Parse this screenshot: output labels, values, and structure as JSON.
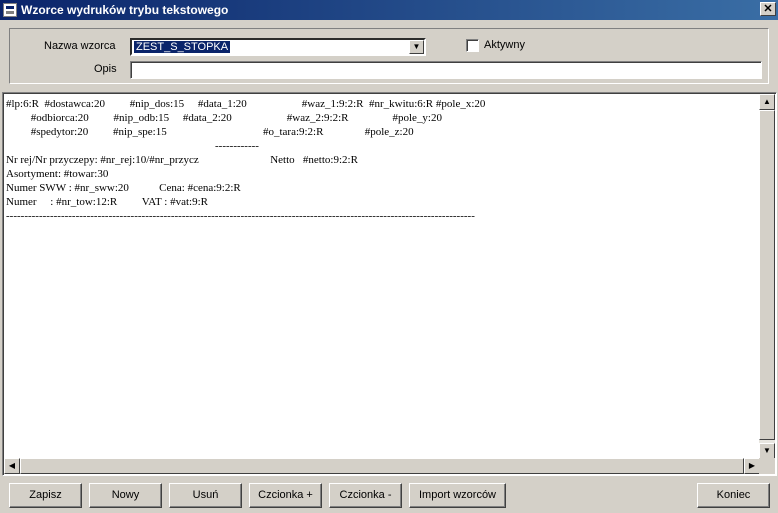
{
  "window": {
    "title": "Wzorce wydruków trybu tekstowego",
    "close_glyph": "✕"
  },
  "form": {
    "name_label": "Nazwa wzorca",
    "name_value": "ZEST_S_STOPKA",
    "active_label": "Aktywny",
    "active_checked": false,
    "description_label": "Opis",
    "description_value": ""
  },
  "editor": {
    "text": "#lp:6:R  #dostawca:20         #nip_dos:15     #data_1:20                    #waz_1:9:2:R  #nr_kwitu:6:R #pole_x:20\n         #odbiorca:20         #nip_odb:15     #data_2:20                    #waz_2:9:2:R                #pole_y:20\n         #spedytor:20         #nip_spe:15                                   #o_tara:9:2:R               #pole_z:20\n                                                                            ------------\nNr rej/Nr przyczepy: #nr_rej:10/#nr_przycz                          Netto   #netto:9:2:R\nAsortyment: #towar:30\nNumer SWW : #nr_sww:20           Cena: #cena:9:2:R\nNumer     : #nr_tow:12:R         VAT : #vat:9:R\n--------------------------------------------------------------------------------------------------------------------------------"
  },
  "buttons": {
    "save": "Zapisz",
    "new": "Nowy",
    "delete": "Usuń",
    "font_plus": "Czcionka +",
    "font_minus": "Czcionka -",
    "import": "Import wzorców",
    "close": "Koniec"
  }
}
